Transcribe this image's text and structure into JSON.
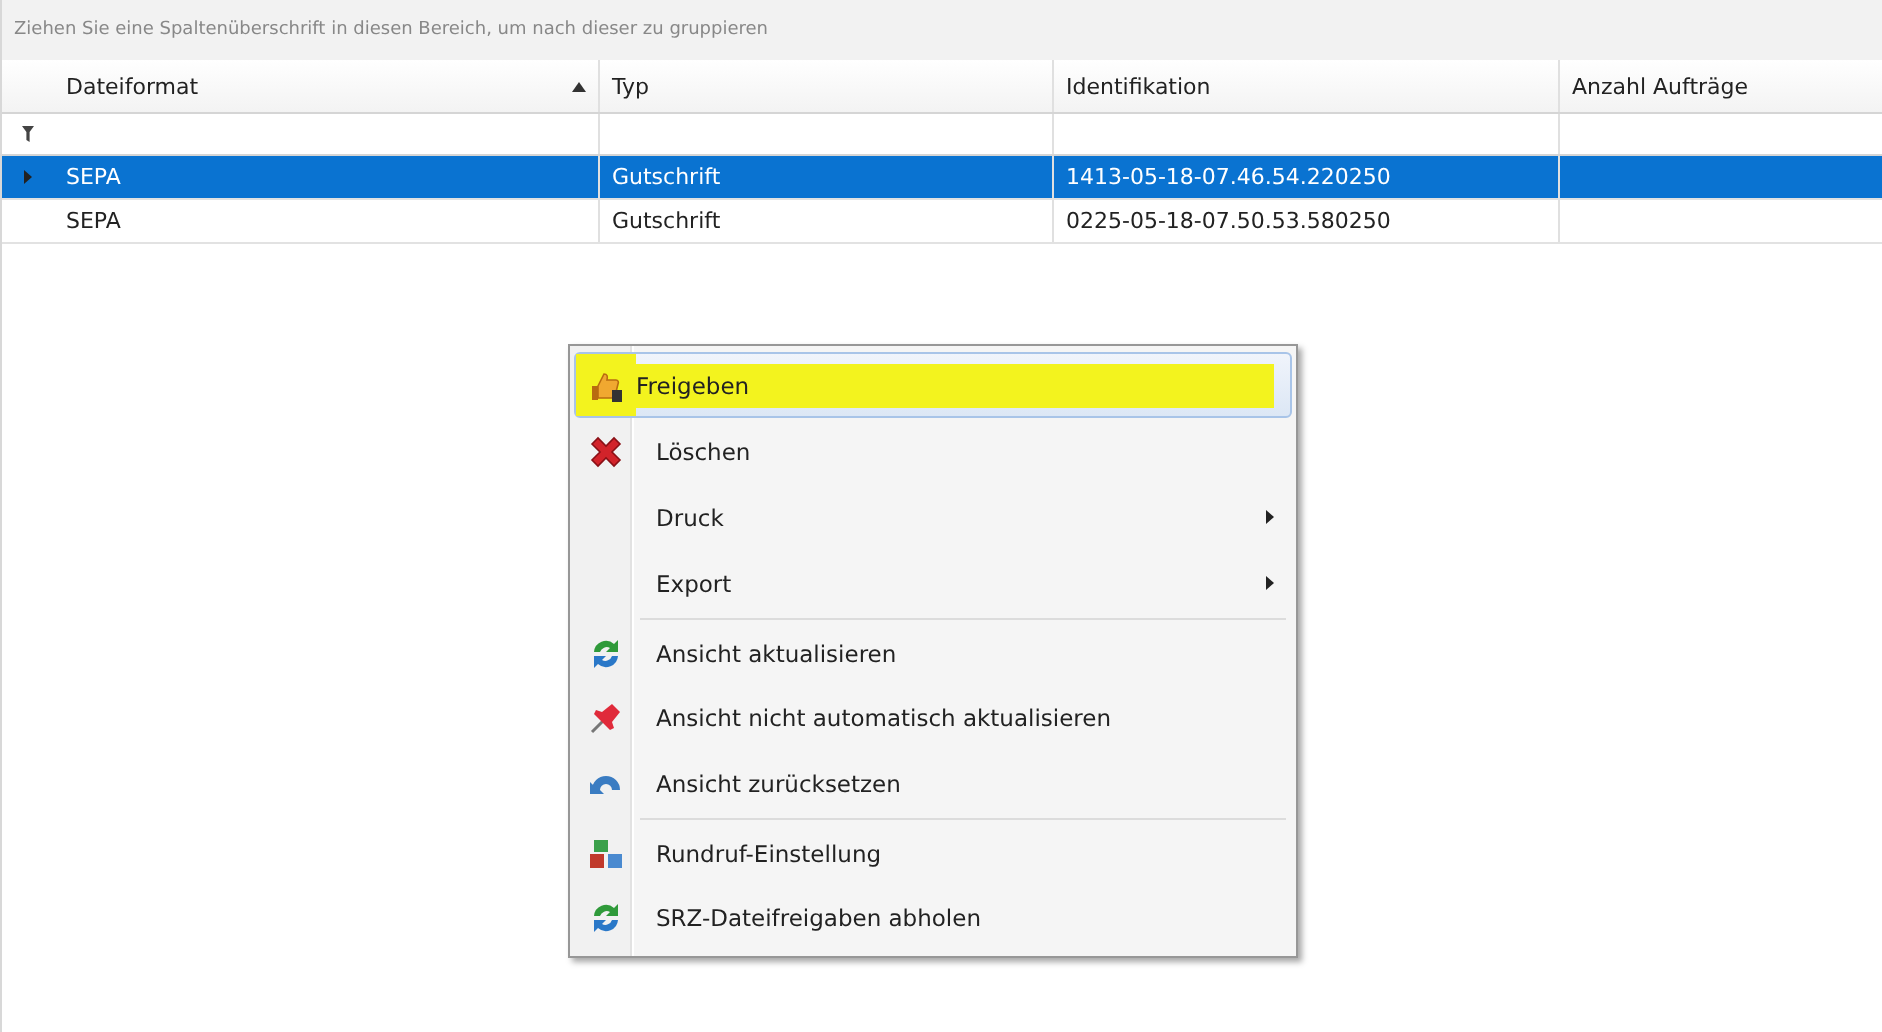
{
  "group_panel": {
    "text": "Ziehen Sie eine Spaltenüberschrift in diesen Bereich, um nach dieser zu gruppieren"
  },
  "table": {
    "columns": [
      {
        "label": "Dateiformat",
        "sorted": true
      },
      {
        "label": "Typ",
        "sorted": false
      },
      {
        "label": "Identifikation",
        "sorted": false
      },
      {
        "label": "Anzahl Aufträge",
        "sorted": false
      }
    ],
    "rows": [
      {
        "selected": true,
        "cells": [
          "SEPA",
          "Gutschrift",
          "1413-05-18-07.46.54.220250",
          ""
        ]
      },
      {
        "selected": false,
        "cells": [
          "SEPA",
          "Gutschrift",
          "0225-05-18-07.50.53.580250",
          ""
        ]
      }
    ]
  },
  "context_menu": {
    "items": [
      {
        "kind": "action",
        "label": "Freigeben",
        "selected": true,
        "highlighted": true,
        "separator_before": false
      },
      {
        "kind": "action",
        "label": "Löschen",
        "selected": false,
        "highlighted": false,
        "separator_before": false
      },
      {
        "kind": "submenu",
        "label": "Druck",
        "selected": false,
        "highlighted": false,
        "separator_before": false
      },
      {
        "kind": "submenu",
        "label": "Export",
        "selected": false,
        "highlighted": false,
        "separator_before": false
      },
      {
        "kind": "action",
        "label": "Ansicht aktualisieren",
        "selected": false,
        "highlighted": false,
        "separator_before": true
      },
      {
        "kind": "action",
        "label": "Ansicht nicht automatisch aktualisieren",
        "selected": false,
        "highlighted": false,
        "separator_before": false
      },
      {
        "kind": "action",
        "label": "Ansicht zurücksetzen",
        "selected": false,
        "highlighted": false,
        "separator_before": false
      },
      {
        "kind": "action",
        "label": "Rundruf-Einstellung",
        "selected": false,
        "highlighted": false,
        "separator_before": true
      },
      {
        "kind": "action",
        "label": "SRZ-Dateifreigaben abholen",
        "selected": false,
        "highlighted": false,
        "separator_before": false
      }
    ]
  }
}
